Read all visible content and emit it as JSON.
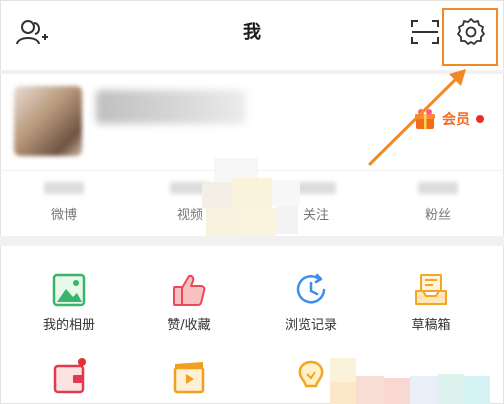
{
  "header": {
    "title": "我",
    "add_friend_icon": "add-friend-icon",
    "scan_icon": "scan-icon",
    "settings_icon": "gear-icon",
    "highlight_color": "#f08a24"
  },
  "profile": {
    "vip_label": "会员",
    "vip_icon": "vip-gift-icon"
  },
  "stats": [
    {
      "label": "微博"
    },
    {
      "label": "视频"
    },
    {
      "label": "关注"
    },
    {
      "label": "粉丝"
    }
  ],
  "grid": [
    {
      "label": "我的相册",
      "icon": "photo-album-icon"
    },
    {
      "label": "赞/收藏",
      "icon": "thumbs-up-icon"
    },
    {
      "label": "浏览记录",
      "icon": "history-clock-icon"
    },
    {
      "label": "草稿箱",
      "icon": "drafts-tray-icon"
    }
  ],
  "grid_row2": [
    {
      "icon": "wallet-icon"
    },
    {
      "icon": "video-clapper-icon"
    },
    {
      "icon": "lightbulb-icon"
    },
    {
      "icon": "wifi-icon"
    }
  ],
  "colors": {
    "accent_orange": "#f36a21",
    "badge_red": "#e5302b"
  }
}
